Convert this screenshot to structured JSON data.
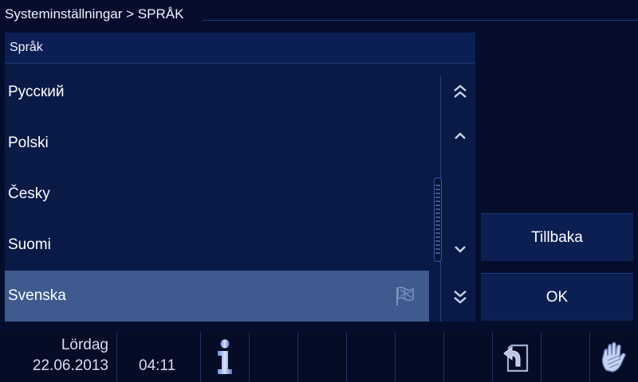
{
  "header": {
    "breadcrumb": "Systeminställningar > SPRÅK"
  },
  "panel": {
    "title": "Språk",
    "items": [
      {
        "label": "Русский",
        "selected": false
      },
      {
        "label": "Polski",
        "selected": false
      },
      {
        "label": "Česky",
        "selected": false
      },
      {
        "label": "Suomi",
        "selected": false
      },
      {
        "label": "Svenska",
        "selected": true,
        "icon": "flag-icon"
      }
    ],
    "scroll_buttons": [
      "double-chevron-up-icon",
      "chevron-up-icon",
      "chevron-down-icon",
      "double-chevron-down-icon"
    ]
  },
  "side_buttons": {
    "back_label": "Tillbaka",
    "ok_label": "OK"
  },
  "bottombar": {
    "day": "Lördag",
    "date": "22.06.2013",
    "time": "04:11",
    "icons": [
      "info-icon",
      "return-icon",
      "hand-clean-icon"
    ]
  },
  "colors": {
    "background": "#040e2c",
    "panel": "#0a1a47",
    "selected_row": "#3e5a8f",
    "button": "#0b1f52"
  }
}
